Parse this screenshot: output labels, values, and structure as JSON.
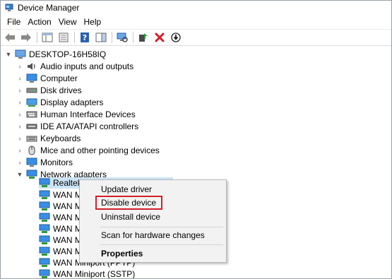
{
  "window": {
    "title": "Device Manager"
  },
  "menu": [
    "File",
    "Action",
    "View",
    "Help"
  ],
  "toolbar_icons": [
    "back-arrow-icon",
    "forward-arrow-icon",
    "show-hide-console-tree-icon",
    "properties-icon",
    "help-icon",
    "action-pane-icon",
    "scan-hardware-icon",
    "update-driver-icon",
    "uninstall-device-icon",
    "disable-device-icon"
  ],
  "tree": {
    "root": "DESKTOP-16H58IQ",
    "categories": [
      "Audio inputs and outputs",
      "Computer",
      "Disk drives",
      "Display adapters",
      "Human Interface Devices",
      "IDE ATA/ATAPI controllers",
      "Keyboards",
      "Mice and other pointing devices",
      "Monitors",
      "Network adapters"
    ],
    "network_children": [
      "Realtek",
      "WAN M",
      "WAN M",
      "WAN M",
      "WAN M",
      "WAN M",
      "WAN M",
      "WAN Miniport (PPTP)",
      "WAN Miniport (SSTP)"
    ]
  },
  "context_menu": {
    "update": "Update driver",
    "disable": "Disable device",
    "uninstall": "Uninstall device",
    "scan": "Scan for hardware changes",
    "properties": "Properties"
  },
  "colors": {
    "highlight": "#d21f2a",
    "selection": "#cce4f7"
  }
}
